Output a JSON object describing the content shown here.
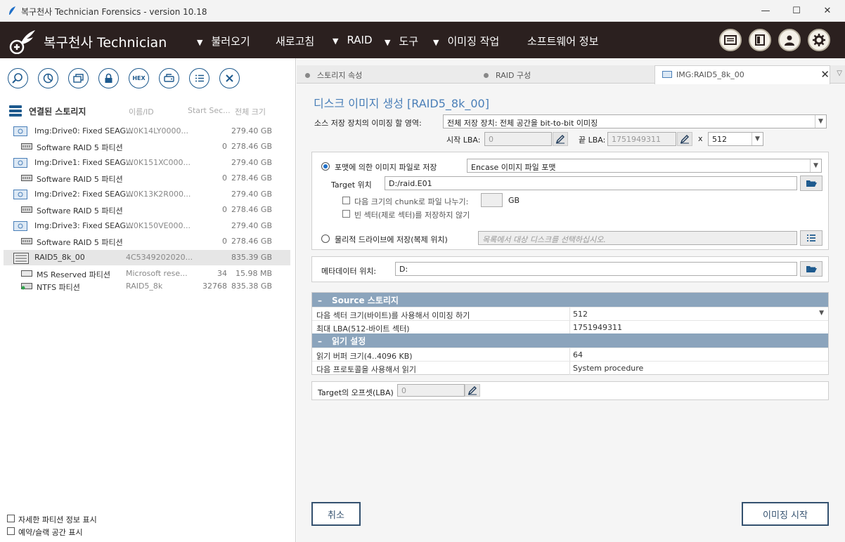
{
  "window": {
    "title": "복구천사 Technician Forensics - version 10.18",
    "minimize": "—",
    "maximize": "☐",
    "close": "✕"
  },
  "header": {
    "brand": "복구천사 Technician",
    "menu": [
      {
        "label": "불러오기",
        "has_arrow": true
      },
      {
        "label": "새로고침",
        "has_arrow": false
      },
      {
        "label": "RAID",
        "has_arrow": true
      },
      {
        "label": "도구",
        "has_arrow": true
      },
      {
        "label": "이미징 작업",
        "has_arrow": true
      },
      {
        "label": "소프트웨어 정보",
        "has_arrow": false
      }
    ],
    "arrow_glyph": "▼",
    "icons": [
      "display-icon",
      "panel-icon",
      "user-icon",
      "settings-icon"
    ]
  },
  "toolbar": {
    "hex_label": "HEX",
    "icons": [
      "search-icon",
      "chart-icon",
      "copy-icon",
      "lock-icon",
      "hex-icon",
      "drive-icon",
      "list-icon",
      "close-icon"
    ]
  },
  "storage": {
    "title": "연결된 스토리지",
    "columns": {
      "name": "이름/ID",
      "start": "Start Sec...",
      "size": "전체 크기"
    },
    "items": [
      {
        "name": "Img:Drive0: Fixed SEAG...",
        "id": "W0K14LY0000...",
        "start": "",
        "size": "279.40 GB",
        "level": 0,
        "icon": "drive-image-icon"
      },
      {
        "name": "Software RAID 5 파티션",
        "id": "",
        "start": "0",
        "size": "278.46 GB",
        "level": 1,
        "icon": "raid-partition-icon"
      },
      {
        "name": "Img:Drive1: Fixed SEAG...",
        "id": "W0K151XC000...",
        "start": "",
        "size": "279.40 GB",
        "level": 0,
        "icon": "drive-image-icon"
      },
      {
        "name": "Software RAID 5 파티션",
        "id": "",
        "start": "0",
        "size": "278.46 GB",
        "level": 1,
        "icon": "raid-partition-icon"
      },
      {
        "name": "Img:Drive2: Fixed SEAG...",
        "id": "W0K13K2R000...",
        "start": "",
        "size": "279.40 GB",
        "level": 0,
        "icon": "drive-image-icon"
      },
      {
        "name": "Software RAID 5 파티션",
        "id": "",
        "start": "0",
        "size": "278.46 GB",
        "level": 1,
        "icon": "raid-partition-icon"
      },
      {
        "name": "Img:Drive3: Fixed SEAG...",
        "id": "W0K150VE000...",
        "start": "",
        "size": "279.40 GB",
        "level": 0,
        "icon": "drive-image-icon"
      },
      {
        "name": "Software RAID 5 파티션",
        "id": "",
        "start": "0",
        "size": "278.46 GB",
        "level": 1,
        "icon": "raid-partition-icon"
      },
      {
        "name": "RAID5_8k_00",
        "id": "4C5349202020...",
        "start": "",
        "size": "835.39 GB",
        "level": 0,
        "icon": "raid-array-icon",
        "selected": true
      },
      {
        "name": "MS Reserved 파티션",
        "id": "Microsoft rese...",
        "start": "34",
        "size": "15.98 MB",
        "level": 1,
        "icon": "partition-icon"
      },
      {
        "name": "NTFS 파티션",
        "id": "RAID5_8k",
        "start": "32768",
        "size": "835.38 GB",
        "level": 1,
        "icon": "ntfs-partition-icon"
      }
    ]
  },
  "left_options": [
    {
      "label": "자세한 파티션 정보 표시",
      "checked": false
    },
    {
      "label": "예약/슬랙 공간 표시",
      "checked": false
    }
  ],
  "tabs": [
    {
      "label": "스토리지 속성",
      "active": false
    },
    {
      "label": "RAID 구성",
      "active": false
    },
    {
      "label": "IMG:RAID5_8k_00",
      "active": true
    }
  ],
  "imaging": {
    "title": "디스크 이미지 생성 [RAID5_8k_00]",
    "source_area_label": "소스 저장 장치의 이미징 할 영역:",
    "source_area_value": "전체 저장 장치: 전체 공간을 bit-to-bit 이미징",
    "start_lba_label": "시작 LBA:",
    "start_lba_value": "0",
    "end_lba_label": "끝 LBA:",
    "end_lba_value": "1751949311",
    "x_label": "x",
    "sector_size": "512",
    "save_file_label": "포맷에 의한 이미지 파일로 저장",
    "save_file_selected": true,
    "format_value": "Encase 이미지 파일 포맷",
    "target_label": "Target 위치",
    "target_value": "D:/raid.E01",
    "chunk_label": "다음 크기의 chunk로 파일 나누기:",
    "chunk_value": "",
    "chunk_unit": "GB",
    "skip_empty_label": "빈 섹터(제로 섹터)를 저장하지 않기",
    "save_drive_label": "물리적 드라이브에 저장(복제 위치)",
    "save_drive_selected": false,
    "save_drive_placeholder": "목록에서 대상 디스크를 선택하십시오.",
    "metadata_label": "메타데이터 위치:",
    "metadata_value": "D:"
  },
  "properties": {
    "source_header": "Source 스토리지",
    "source_rows": [
      {
        "key": "다음 섹터 크기(바이트)를 사용해서 이미징 하기",
        "value": "512",
        "dropdown": true
      },
      {
        "key": "최대 LBA(512-바이트 섹터)",
        "value": "1751949311",
        "dropdown": false
      }
    ],
    "read_header": "읽기 설정",
    "read_rows": [
      {
        "key": "읽기 버퍼 크기(4..4096 KB)",
        "value": "64"
      },
      {
        "key": "다음 프로토콜을 사용해서 읽기",
        "value": "System procedure"
      }
    ],
    "collapse_glyph": "–"
  },
  "offset": {
    "label": "Target의 오프셋(LBA)",
    "value": "0"
  },
  "buttons": {
    "cancel": "취소",
    "start": "이미징 시작"
  },
  "colors": {
    "header_bg": "#2b201f",
    "accent": "#4a7fb8",
    "prop_header": "#8ba4bc",
    "button_border": "#34516f"
  }
}
